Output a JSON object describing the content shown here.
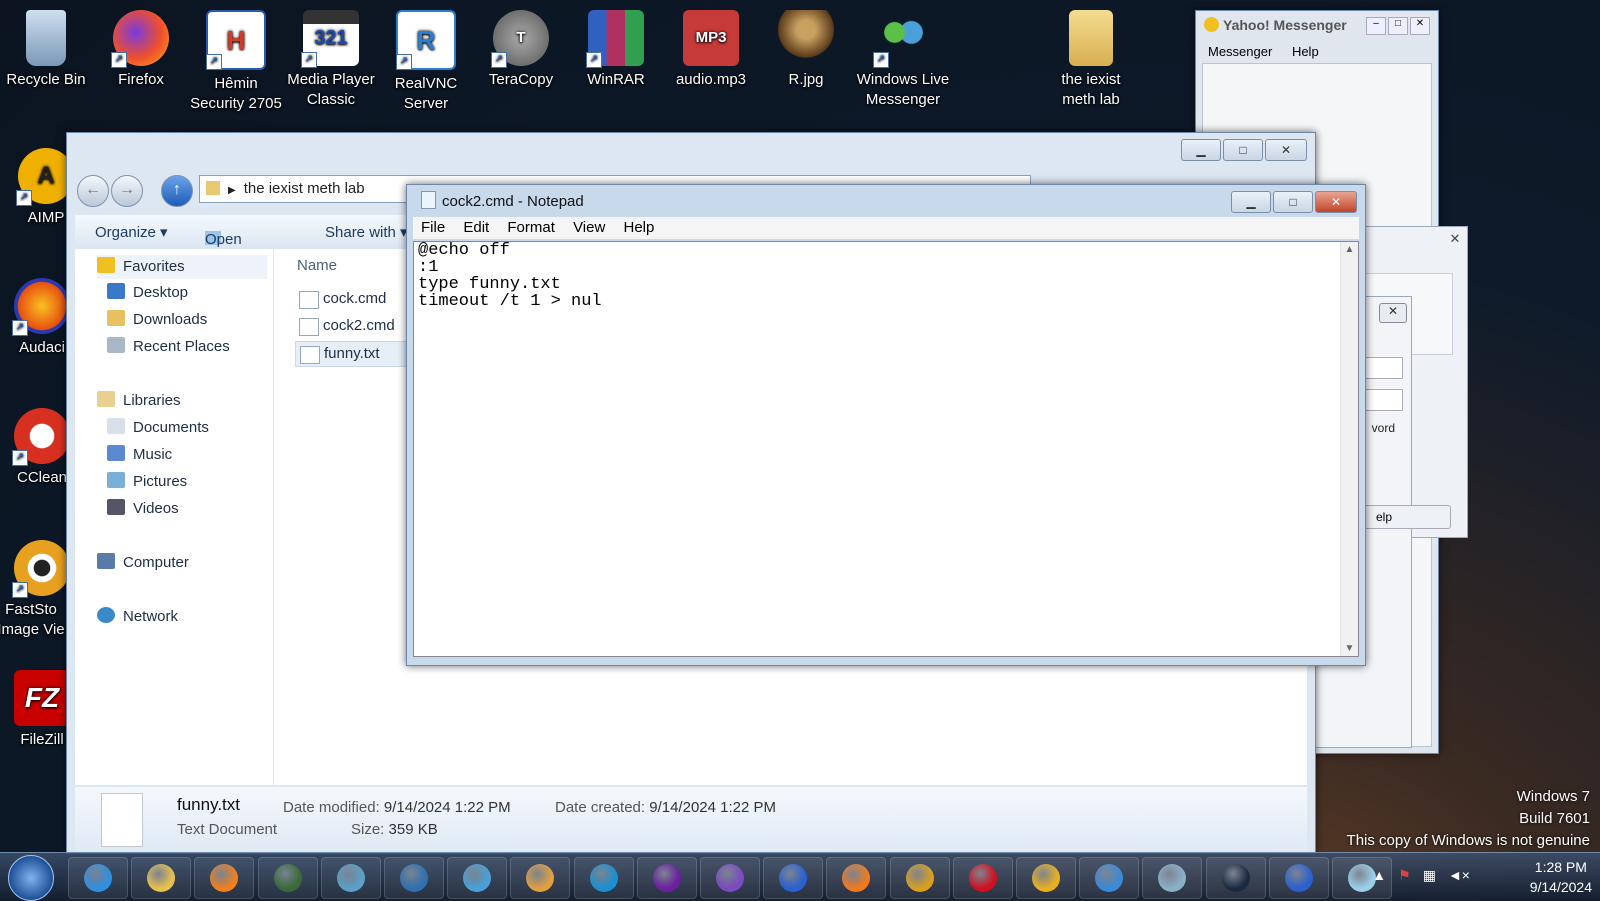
{
  "desktop": {
    "icons": [
      {
        "label": "Recycle Bin",
        "icon": "recycle-bin-icon",
        "color": "#8fb0d0"
      },
      {
        "label": "Firefox",
        "icon": "firefox-icon",
        "color": "#f07a1f"
      },
      {
        "label": "Hêmin Security 2705",
        "icon": "shield-icon",
        "color": "#d43a2a"
      },
      {
        "label": "Media Player Classic",
        "icon": "clapperboard-icon",
        "color": "#333333"
      },
      {
        "label": "RealVNC Server",
        "icon": "vnc-icon",
        "color": "#2a7fd0"
      },
      {
        "label": "TeraCopy",
        "icon": "teracopy-icon",
        "color": "#6a6a6a"
      },
      {
        "label": "WinRAR",
        "icon": "archive-icon",
        "color": "#b03060"
      },
      {
        "label": "audio.mp3",
        "icon": "mp3-file-icon",
        "color": "#c73a3a",
        "text": "MP3"
      },
      {
        "label": "R.jpg",
        "icon": "image-file-icon",
        "color": "#7a5a2a"
      },
      {
        "label": "Windows Live Messenger",
        "icon": "messenger-icon",
        "color": "#4aa0d8"
      },
      {
        "label": "the iexist meth lab",
        "icon": "folder-icon",
        "color": "#e8c870"
      }
    ],
    "left_icons": [
      {
        "label": "AIMP",
        "icon": "aimp-icon",
        "color": "#f0b000"
      },
      {
        "label": "Audaci",
        "icon": "audacity-icon",
        "color": "#e85010"
      },
      {
        "label": "CClean",
        "icon": "ccleaner-icon",
        "color": "#d83020"
      },
      {
        "label": "FastSto Image Vie",
        "icon": "eye-icon",
        "color": "#e8a020"
      },
      {
        "label": "FileZill",
        "icon": "filezilla-icon",
        "color": "#c80000",
        "text": "FZ"
      }
    ]
  },
  "explorer": {
    "address": "the iexist meth lab",
    "toolbar": {
      "organize": "Organize ▾",
      "open": "Open ▾",
      "share": "Share with ▾"
    },
    "nav": {
      "favorites": "Favorites",
      "desktop": "Desktop",
      "downloads": "Downloads",
      "recent": "Recent Places",
      "libraries": "Libraries",
      "documents": "Documents",
      "music": "Music",
      "pictures": "Pictures",
      "videos": "Videos",
      "computer": "Computer",
      "network": "Network"
    },
    "column_name": "Name",
    "files": [
      "cock.cmd",
      "cock2.cmd",
      "funny.txt"
    ],
    "details": {
      "name": "funny.txt",
      "type": "Text Document",
      "modified_label": "Date modified:",
      "modified": "9/14/2024 1:22 PM",
      "created_label": "Date created:",
      "created": "9/14/2024 1:22 PM",
      "size_label": "Size:",
      "size": "359 KB"
    }
  },
  "notepad": {
    "title": "cock2.cmd - Notepad",
    "menu": [
      "File",
      "Edit",
      "Format",
      "View",
      "Help"
    ],
    "content": "@echo off\n:1\ntype funny.txt\ntimeout /t 1 > nul"
  },
  "yahoo": {
    "title": "Yahoo! Messenger",
    "menu": [
      "Messenger",
      "Help"
    ],
    "partial_text_word": "vord",
    "partial_text_help": "elp"
  },
  "watermark": {
    "line1": "Windows 7",
    "line2": "Build 7601",
    "line3": "This copy of Windows is not genuine"
  },
  "taskbar": {
    "apps": [
      {
        "icon": "internet-explorer-icon",
        "color": "#2f8fe0"
      },
      {
        "icon": "file-explorer-icon",
        "color": "#e8c050"
      },
      {
        "icon": "media-player-icon",
        "color": "#f08020"
      },
      {
        "icon": "terminal-icon",
        "color": "#3a6a3a"
      },
      {
        "icon": "globe-icon",
        "color": "#5aa0c8"
      },
      {
        "icon": "network-app-icon",
        "color": "#3070b0"
      },
      {
        "icon": "messenger-icon",
        "color": "#4aa0d8"
      },
      {
        "icon": "paint-icon",
        "color": "#e0a040"
      },
      {
        "icon": "edge-icon",
        "color": "#1a90d0"
      },
      {
        "icon": "yahoo-messenger-icon",
        "color": "#6a1fa0"
      },
      {
        "icon": "visual-studio-icon",
        "color": "#7a4ac0"
      },
      {
        "icon": "leaf-app-icon",
        "color": "#2a60d0"
      },
      {
        "icon": "firefox-icon",
        "color": "#f07a1f"
      },
      {
        "icon": "chrome-icon",
        "color": "#d8a020"
      },
      {
        "icon": "opera-icon",
        "color": "#d01020"
      },
      {
        "icon": "ring-app-icon",
        "color": "#e8b020"
      },
      {
        "icon": "windows-logo-icon",
        "color": "#3a8ad8"
      },
      {
        "icon": "network-tool-icon",
        "color": "#8ab0c8"
      },
      {
        "icon": "steam-icon",
        "color": "#1a2a40"
      },
      {
        "icon": "blue-app-icon",
        "color": "#2a60d0"
      },
      {
        "icon": "notepad-icon",
        "color": "#9ad0e8"
      }
    ],
    "time": "1:28 PM",
    "date": "9/14/2024"
  }
}
